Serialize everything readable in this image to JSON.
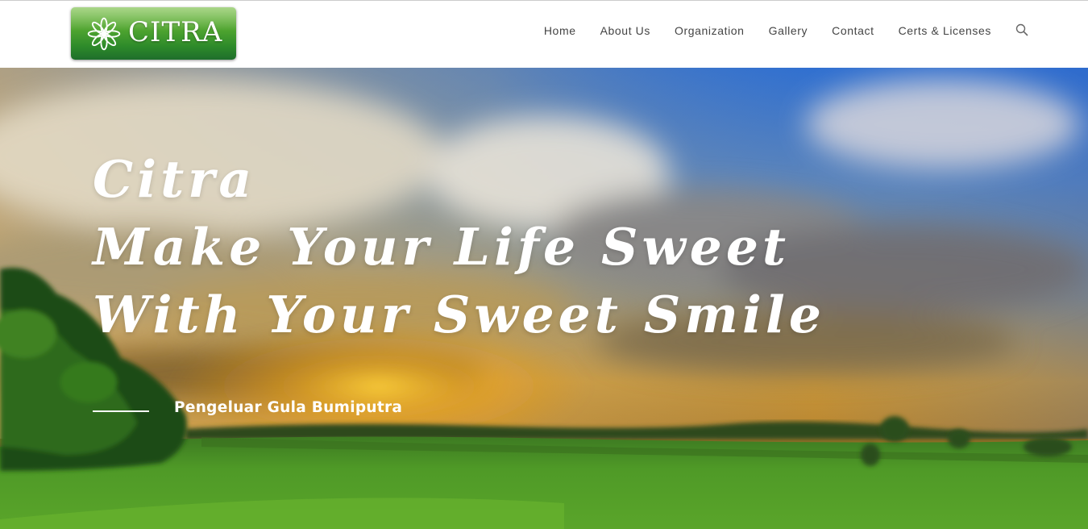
{
  "brand": {
    "logo_text": "CITRA",
    "logo_color": "#3f9b32"
  },
  "nav": {
    "items": [
      {
        "label": "Home"
      },
      {
        "label": "About Us"
      },
      {
        "label": "Organization"
      },
      {
        "label": "Gallery"
      },
      {
        "label": "Contact"
      },
      {
        "label": "Certs & Licenses"
      }
    ],
    "search_icon": "search-icon"
  },
  "hero": {
    "title_lines": [
      "Citra",
      "Make Your Life Sweet",
      "With Your Sweet Smile"
    ],
    "subtitle": "Pengeluar Gula Bumiputra",
    "background": "sunset-over-green-field"
  }
}
